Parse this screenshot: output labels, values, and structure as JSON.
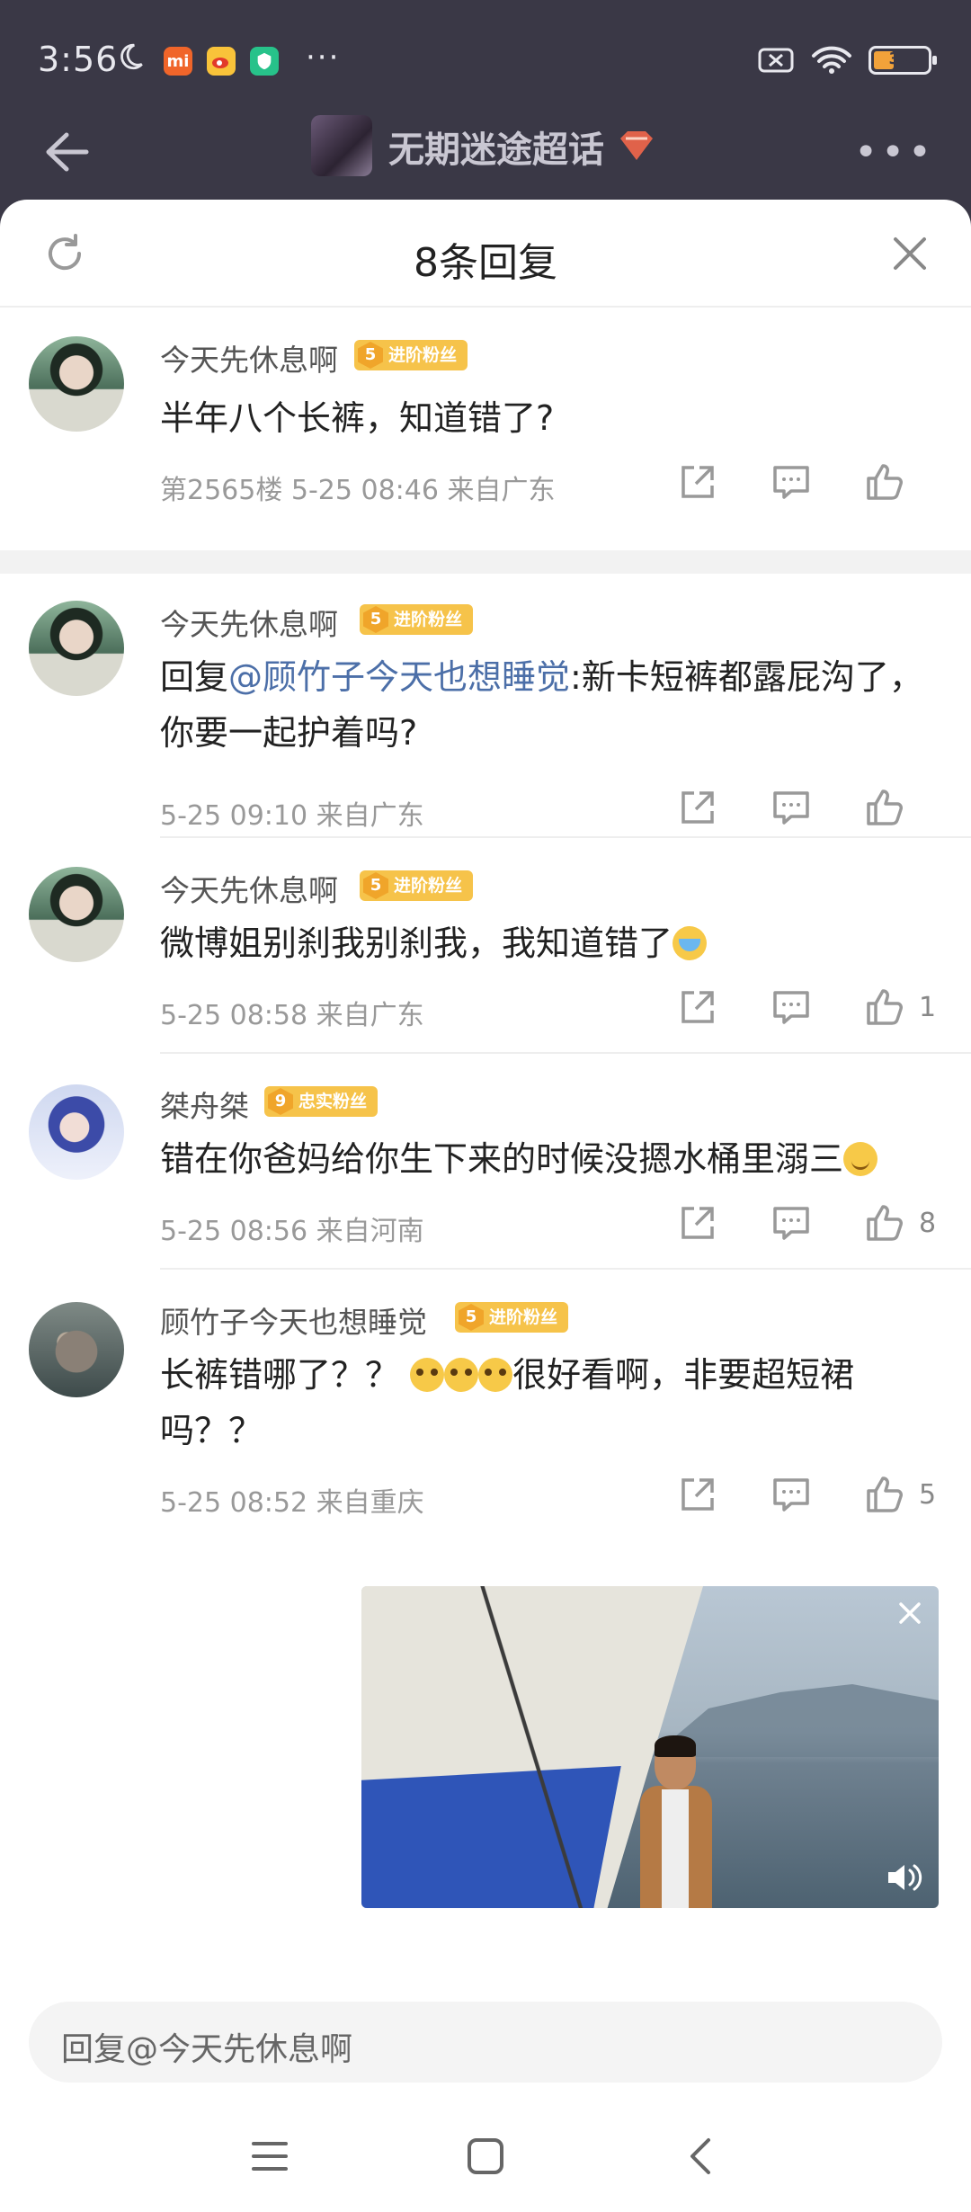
{
  "status_bar": {
    "time": "3:56",
    "battery": "35",
    "more": "···"
  },
  "nav": {
    "title": "无期迷途超话",
    "more": "•••"
  },
  "sheet": {
    "title": "8条回复"
  },
  "comments": [
    {
      "user": "今天先休息啊",
      "badge_level": "5",
      "badge_text": "进阶粉丝",
      "text": "半年八个长裤，知道错了?",
      "meta": "第2565楼  5-25 08:46  来自广东",
      "likes": ""
    },
    {
      "user": "今天先休息啊",
      "badge_level": "5",
      "badge_text": "进阶粉丝",
      "text_prefix": "回复",
      "mention": "@顾竹子今天也想睡觉",
      "text": ":新卡短裤都露屁沟了，你要一起护着吗?",
      "meta": "5-25 09:10  来自广东",
      "likes": ""
    },
    {
      "user": "今天先休息啊",
      "badge_level": "5",
      "badge_text": "进阶粉丝",
      "text": "微博姐别刹我别刹我，我知道错了",
      "meta": "5-25 08:58  来自广东",
      "likes": "1"
    },
    {
      "user": "桀舟桀",
      "badge_level": "9",
      "badge_text": "忠实粉丝",
      "text": "错在你爸妈给你生下来的时候没摁水桶里溺三",
      "meta": "5-25 08:56  来自河南",
      "likes": "8"
    },
    {
      "user": "顾竹子今天也想睡觉",
      "badge_level": "5",
      "badge_text": "进阶粉丝",
      "text_a": "长裤错哪了？？",
      "text_b": "很好看啊，非要超短裙吗？？",
      "meta": "5-25 08:52  来自重庆",
      "likes": "5"
    }
  ],
  "reply_box": {
    "placeholder": "回复@今天先休息啊"
  },
  "colors": {
    "header_bg": "#3a3846",
    "mention": "#4c6fa8",
    "badge": "#f6c34a"
  }
}
